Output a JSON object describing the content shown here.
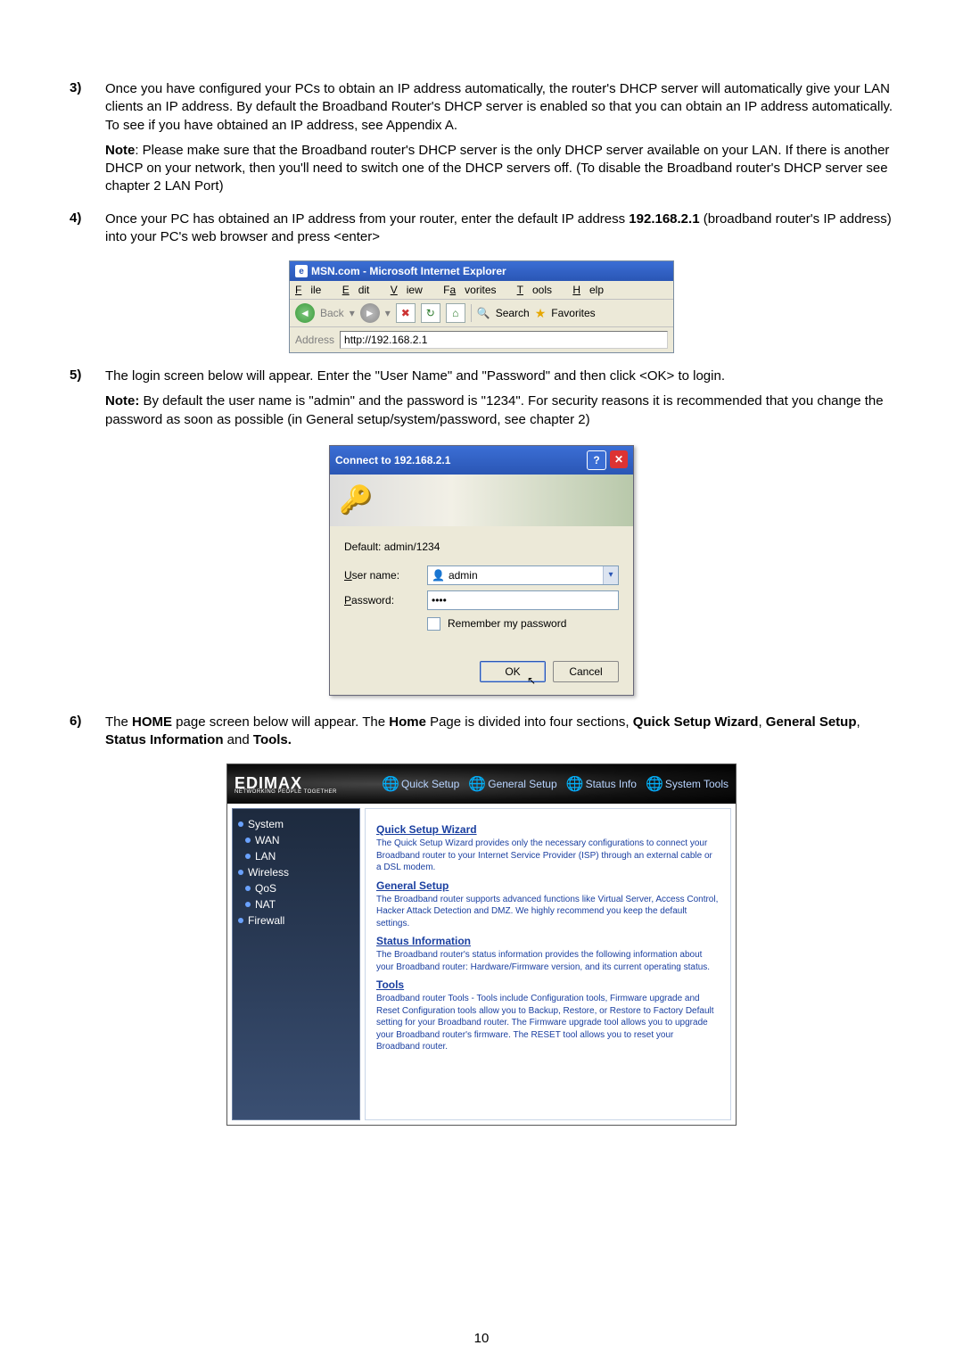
{
  "steps": {
    "s3": {
      "num": "3)",
      "p1": "Once you have configured your PCs to obtain an IP address automatically, the router's DHCP server will automatically give your LAN clients an IP address. By default the Broadband Router's DHCP server is enabled so that you can obtain an IP address automatically. To see if you have obtained an IP address, see Appendix A.",
      "note_label": "Note",
      "note": ": Please make sure that the Broadband router's DHCP server is the only DHCP server available on your LAN. If there is another DHCP on your network, then you'll need to switch one of the DHCP servers off. (To disable the Broadband router's DHCP server see chapter 2 LAN Port)"
    },
    "s4": {
      "num": "4)",
      "pre": "Once your PC has obtained an IP address from your router, enter the default IP address ",
      "ip": "192.168.2.1",
      "post": " (broadband router's IP address) into your PC's web browser and press <enter>"
    },
    "s5": {
      "num": "5)",
      "p1": "The login screen below will appear. Enter the \"User Name\" and \"Password\" and then click <OK> to login.",
      "note_label": "Note:",
      "note": " By default the user name is \"admin\" and the password is \"1234\". For security reasons it is recommended that you change the password as soon as possible (in General setup/system/password, see chapter 2)"
    },
    "s6": {
      "num": "6)",
      "t1": "The ",
      "b1": "HOME",
      "t2": " page screen below will appear. The ",
      "b2": "Home",
      "t3": " Page is divided into four sections, ",
      "b3": "Quick Setup Wizard",
      "t4": ", ",
      "b4": "General Setup",
      "t5": ", ",
      "b5": "Status Information",
      "t6": " and ",
      "b6": "Tools.",
      "t7": ""
    }
  },
  "ie": {
    "title": "MSN.com - Microsoft Internet Explorer",
    "menu": {
      "file": "File",
      "edit": "Edit",
      "view": "View",
      "fav": "Favorites",
      "tools": "Tools",
      "help": "Help"
    },
    "tb": {
      "back": "Back",
      "search": "Search",
      "fav": "Favorites"
    },
    "addr_lbl": "Address",
    "addr_val": "http://192.168.2.1"
  },
  "dlg": {
    "title": "Connect to 192.168.2.1",
    "realm": "Default: admin/1234",
    "user_lbl": "User name:",
    "user_val": "admin",
    "pass_lbl": "Password:",
    "pass_val": "••••",
    "remember": "Remember my password",
    "ok": "OK",
    "cancel": "Cancel"
  },
  "router": {
    "brand": "EDIMAX",
    "brand_sub": "NETWORKING PEOPLE TOGETHER",
    "tabs": {
      "quick": "Quick Setup",
      "general": "General Setup",
      "status": "Status Info",
      "tools": "System Tools"
    },
    "side": [
      "System",
      "WAN",
      "LAN",
      "Wireless",
      "QoS",
      "NAT",
      "Firewall"
    ],
    "sections": {
      "quick": {
        "h": "Quick Setup Wizard",
        "t": "The Quick Setup Wizard provides only the necessary configurations to connect your Broadband router to your Internet Service Provider (ISP) through an external cable or a DSL modem."
      },
      "general": {
        "h": "General Setup",
        "t": "The Broadband router supports advanced functions like Virtual Server, Access Control, Hacker Attack Detection and DMZ. We highly recommend you keep the default settings."
      },
      "status": {
        "h": "Status Information",
        "t": "The Broadband router's status information provides the following information about your Broadband router: Hardware/Firmware version, and its current operating status."
      },
      "tools": {
        "h": "Tools",
        "t": "Broadband router Tools - Tools include Configuration tools, Firmware upgrade and Reset Configuration tools allow you to Backup, Restore, or Restore to Factory Default setting for your Broadband router. The Firmware upgrade tool allows you to upgrade your Broadband router's firmware. The RESET tool allows you to reset your Broadband router."
      }
    }
  },
  "page_num": "10"
}
